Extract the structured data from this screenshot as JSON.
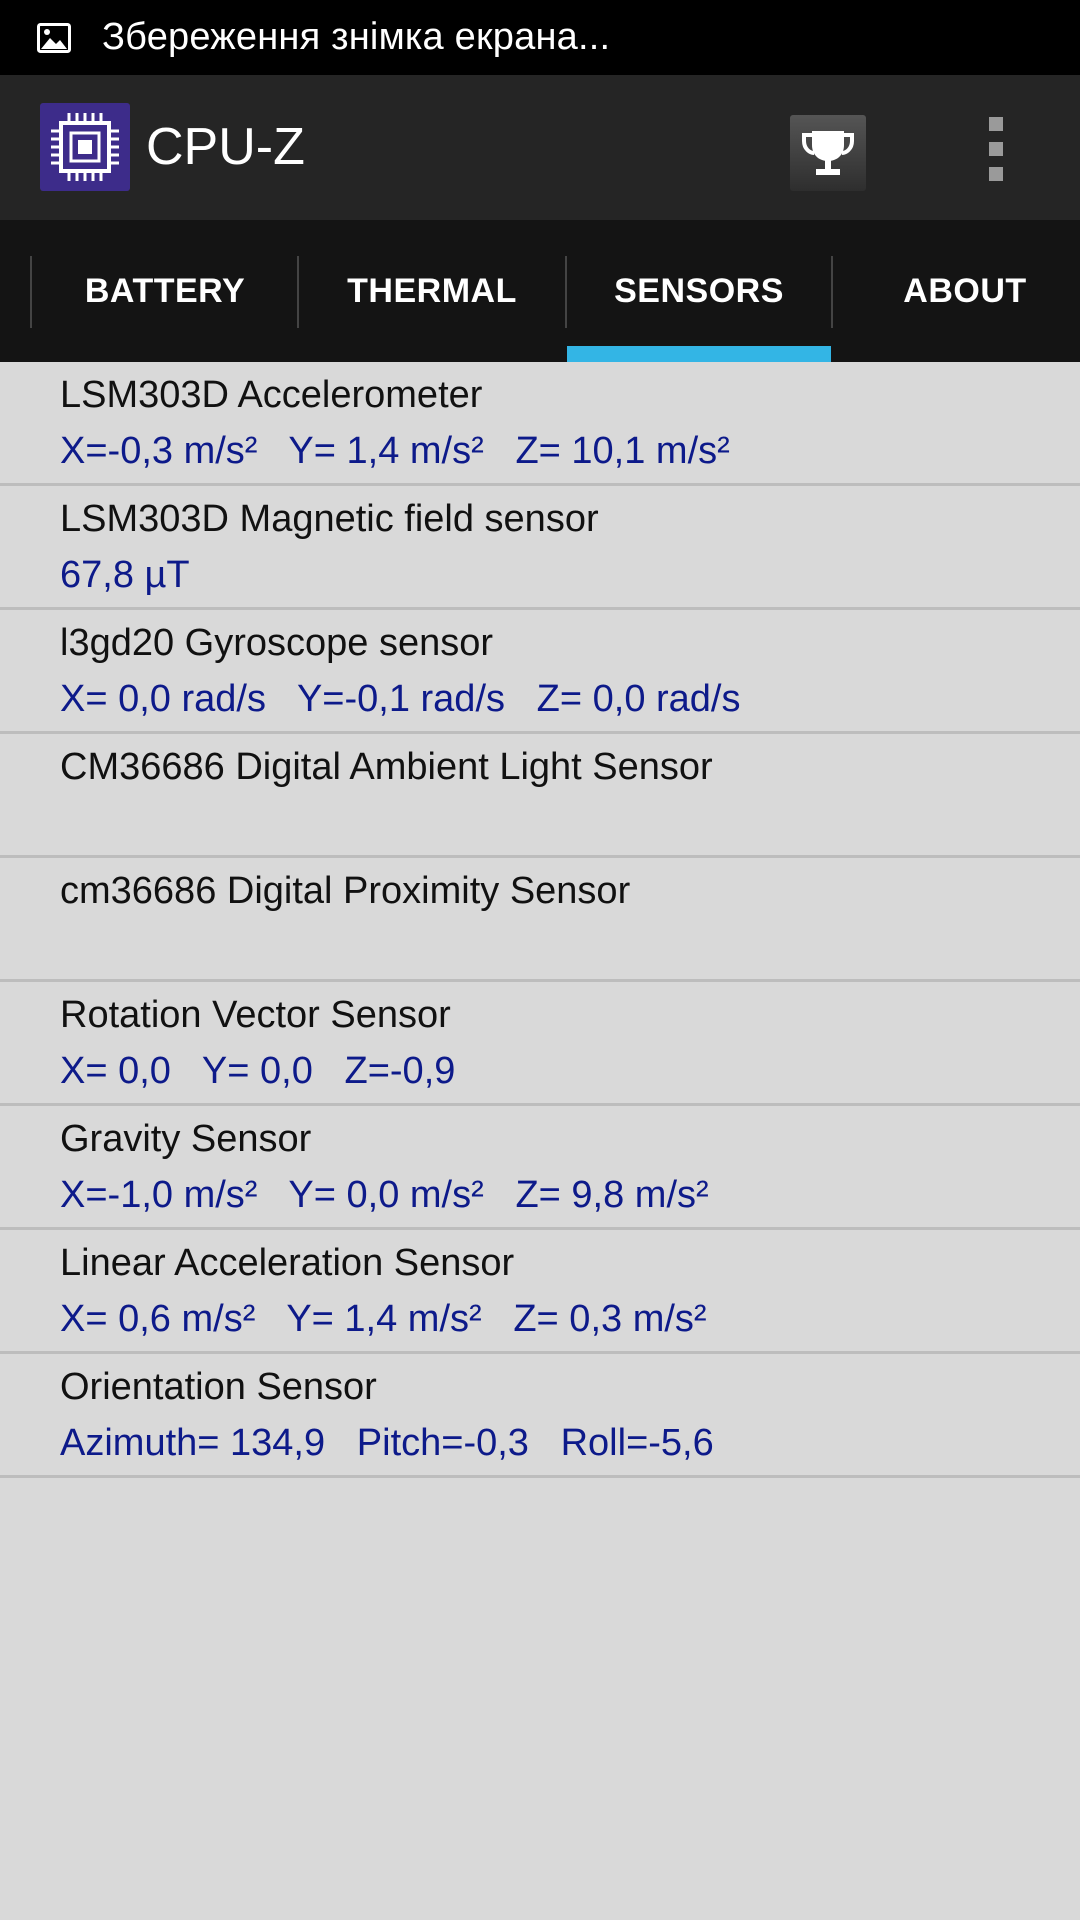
{
  "status_bar": {
    "notification_icon": "image-icon",
    "text": "Збереження знімка екрана..."
  },
  "app_bar": {
    "title": "CPU-Z",
    "logo_icon": "cpu-chip-icon",
    "trophy_icon": "trophy-icon",
    "overflow_icon": "overflow-menu-icon"
  },
  "tabs": [
    {
      "label": "BATTERY"
    },
    {
      "label": "THERMAL"
    },
    {
      "label": "SENSORS"
    },
    {
      "label": "ABOUT"
    }
  ],
  "selected_tab": "SENSORS",
  "colors": {
    "accent": "#33b5e5",
    "value_text": "#0d1a8a",
    "background": "#d9d9d9"
  },
  "sensors": [
    {
      "name": "LSM303D Accelerometer",
      "value": "X=-0,3 m/s²   Y= 1,4 m/s²   Z= 10,1 m/s²"
    },
    {
      "name": "LSM303D Magnetic field sensor",
      "value": "67,8 µT"
    },
    {
      "name": "l3gd20 Gyroscope sensor",
      "value": "X= 0,0 rad/s   Y=-0,1 rad/s   Z= 0,0 rad/s"
    },
    {
      "name": "CM36686 Digital Ambient Light Sensor",
      "value": ""
    },
    {
      "name": "cm36686 Digital Proximity Sensor",
      "value": ""
    },
    {
      "name": "Rotation Vector Sensor",
      "value": "X= 0,0   Y= 0,0   Z=-0,9"
    },
    {
      "name": "Gravity Sensor",
      "value": "X=-1,0 m/s²   Y= 0,0 m/s²   Z= 9,8 m/s²"
    },
    {
      "name": "Linear Acceleration Sensor",
      "value": "X= 0,6 m/s²   Y= 1,4 m/s²   Z= 0,3 m/s²"
    },
    {
      "name": "Orientation Sensor",
      "value": "Azimuth= 134,9   Pitch=-0,3   Roll=-5,6"
    }
  ]
}
